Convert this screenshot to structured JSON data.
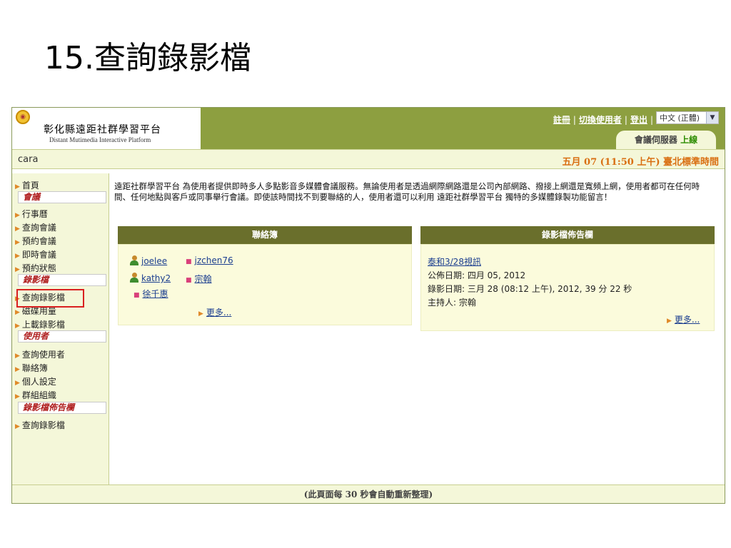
{
  "slide": {
    "title": "15.查詢錄影檔"
  },
  "header": {
    "org_name": "彰化縣遠距社群學習平台",
    "org_sub": "Distant Mutimedia Interactive Platform",
    "links": {
      "register": "註冊",
      "switch_user": "切換使用者",
      "logout": "登出",
      "sep": "|"
    },
    "language": "中文 (正體)",
    "server_label": "會議伺服器",
    "server_status": "上線"
  },
  "userbar": {
    "username": "cara",
    "datetime": "五月 07 (11:50 上午) 臺北標準時間"
  },
  "sidebar": {
    "home": "首頁",
    "sec_meeting": "會議",
    "calendar": "行事曆",
    "query_meeting": "查詢會議",
    "book_meeting": "預約會議",
    "instant_meeting": "即時會議",
    "booking_status": "預約狀態",
    "sec_recording": "錄影檔",
    "query_recording": "查詢錄影檔",
    "disk_usage": "磁碟用量",
    "upload_recording": "上載錄影檔",
    "sec_user": "使用者",
    "query_user": "查詢使用者",
    "contacts": "聯絡簿",
    "personal_settings": "個人設定",
    "group_org": "群組組織",
    "sec_board": "錄影檔佈告欄",
    "board_query": "查詢錄影檔"
  },
  "intro": "遠距社群學習平台 為使用者提供即時多人多點影音多媒體會議服務。無論使用者是透過網際網路還是公司內部網路、撥接上網還是寬頻上網，使用者都可在任何時間、任何地點與客戶或同事舉行會議。即使該時間找不到要聯絡的人，使用者還可以利用 遠距社群學習平台 獨特的多媒體錄製功能留言！",
  "contacts_panel": {
    "title": "聯絡簿",
    "c1": "joelee",
    "c2": "jzchen76",
    "c3": "kathy2",
    "c4": "宗翰",
    "c5": "徐千惠",
    "more": "更多..."
  },
  "recording_panel": {
    "title": "錄影檔佈告欄",
    "item_title": "泰和3/28視訊",
    "publish_date": "公佈日期: 四月 05, 2012",
    "record_date": "錄影日期: 三月 28 (08:12 上午), 2012, 39 分 22 秒",
    "host": "主持人: 宗翰",
    "more": "更多..."
  },
  "footer": "(此頁面每 30 秒會自動重新整理)",
  "colors": {
    "header_green": "#8d9f40",
    "panel_header": "#6a6f2c",
    "pale": "#f4f7d9",
    "accent_orange": "#d96f12",
    "highlight_red": "#d92020"
  }
}
